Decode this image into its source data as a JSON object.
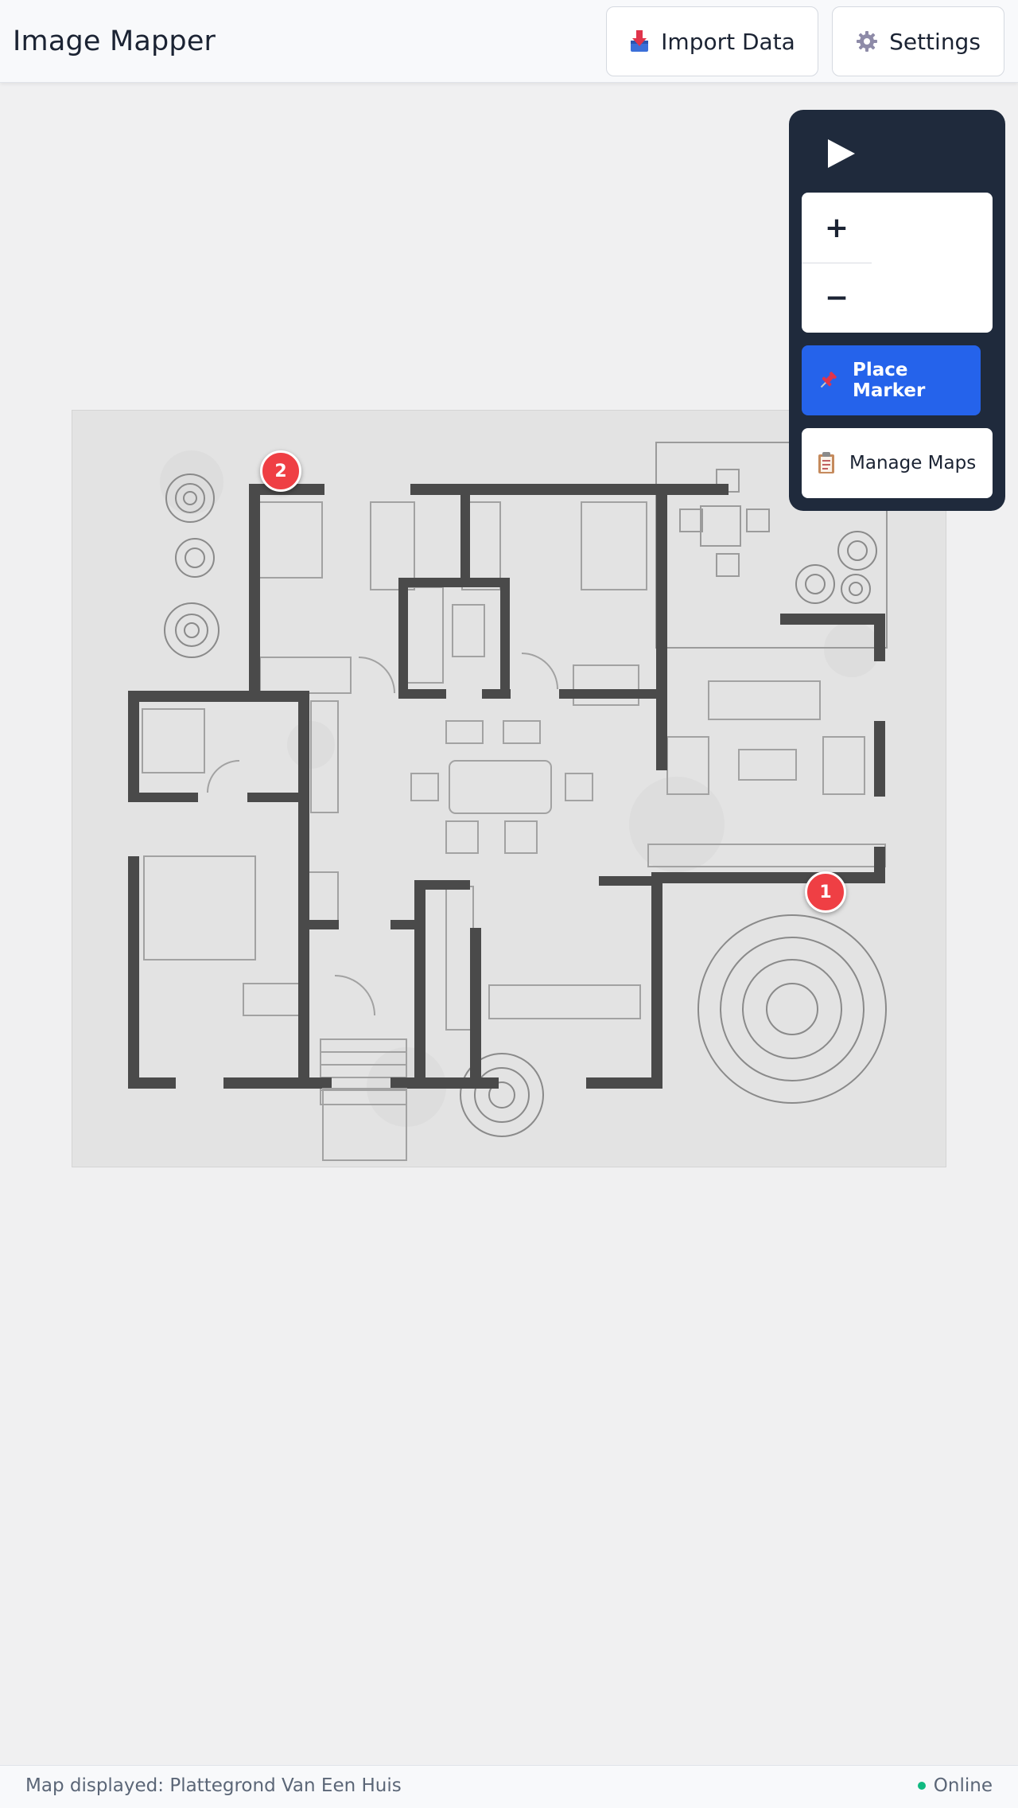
{
  "header": {
    "title": "Image Mapper",
    "import_label": "Import Data",
    "import_icon": "import-tray-icon",
    "settings_label": "Settings",
    "settings_icon": "gear-icon"
  },
  "controls": {
    "toggle_icon": "play-triangle-icon",
    "zoom_in_label": "+",
    "zoom_out_label": "−",
    "place_marker_label": "Place Marker",
    "place_marker_icon": "pushpin-icon",
    "manage_maps_label": "Manage Maps",
    "manage_maps_icon": "clipboard-icon"
  },
  "markers": [
    {
      "label": "1",
      "color": "#ef3f44"
    },
    {
      "label": "2",
      "color": "#ef3f44"
    }
  ],
  "footer": {
    "map_text": "Map displayed: Plattegrond Van Een Huis",
    "status": "Online",
    "status_color": "#10b981"
  },
  "colors": {
    "accent": "#2563eb",
    "panel": "#1f2a3c",
    "marker": "#ef3f44"
  }
}
